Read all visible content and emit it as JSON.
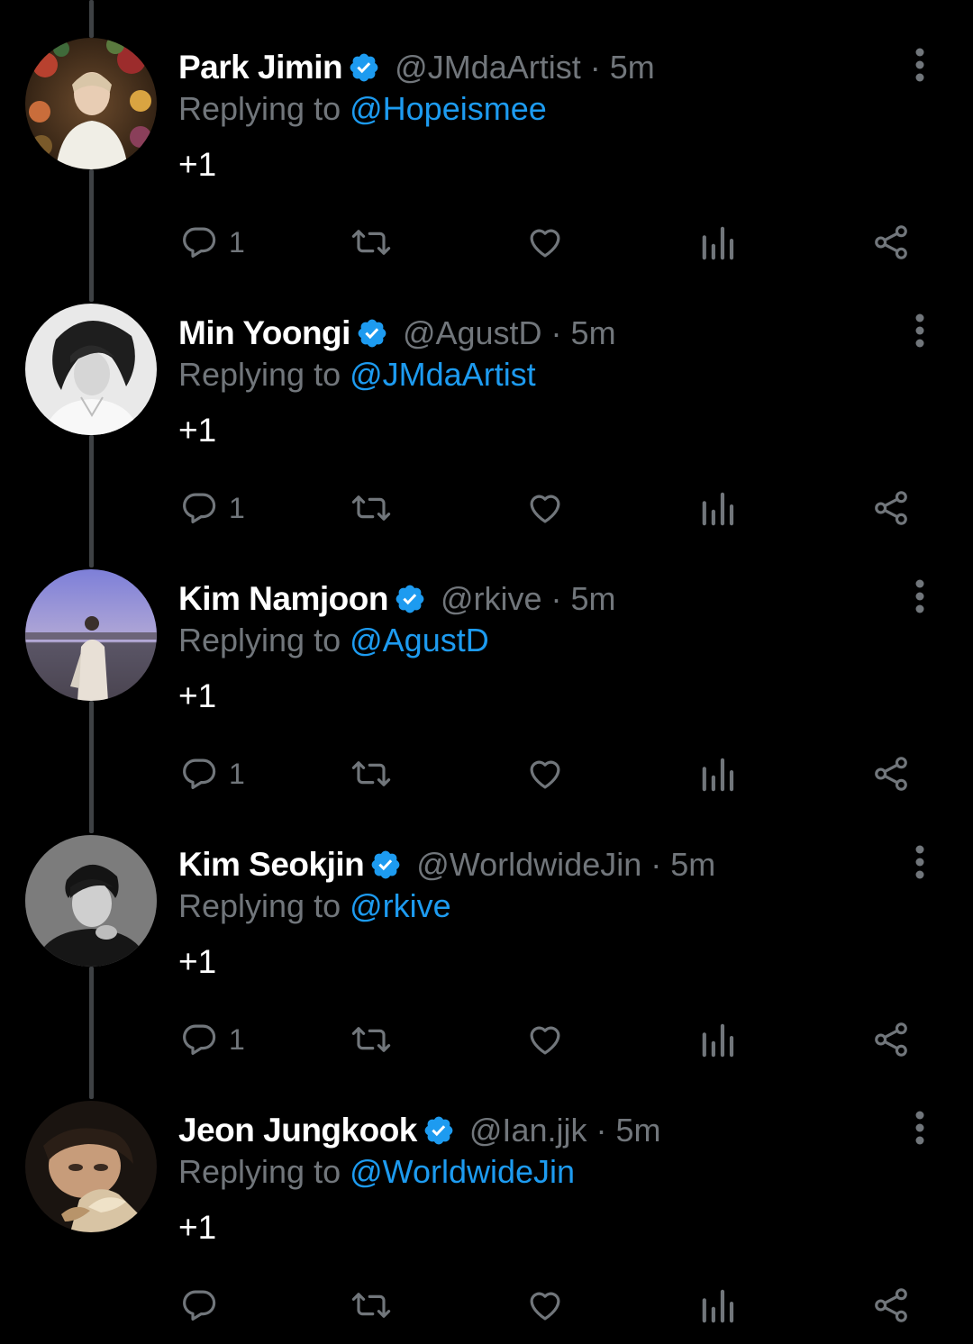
{
  "colors": {
    "background": "#000000",
    "name": "#ffffff",
    "secondary": "#71767b",
    "mention": "#1d9bf0",
    "verified": "#1d9bf0",
    "thread_line": "#3e4144"
  },
  "icons": {
    "reply": "reply-icon",
    "retweet": "retweet-icon",
    "like": "heart-icon",
    "views": "bar-chart-icon",
    "share": "share-icon",
    "more": "more-vertical-icon",
    "verified": "verified-badge-icon"
  },
  "tweets": [
    {
      "name": "Park Jimin",
      "handle": "@JMdaArtist",
      "separator": "·",
      "time": "5m",
      "replying_prefix": "Replying to ",
      "replying_to": "@Hopeismee",
      "text": "+1",
      "reply_count": "1"
    },
    {
      "name": "Min Yoongi",
      "handle": "@AgustD",
      "separator": "·",
      "time": "5m",
      "replying_prefix": "Replying to ",
      "replying_to": "@JMdaArtist",
      "text": "+1",
      "reply_count": "1"
    },
    {
      "name": "Kim Namjoon",
      "handle": "@rkive",
      "separator": "·",
      "time": "5m",
      "replying_prefix": "Replying to ",
      "replying_to": "@AgustD",
      "text": "+1",
      "reply_count": "1"
    },
    {
      "name": "Kim Seokjin",
      "handle": "@WorldwideJin",
      "separator": "·",
      "time": "5m",
      "replying_prefix": "Replying to ",
      "replying_to": "@rkive",
      "text": "+1",
      "reply_count": "1"
    },
    {
      "name": "Jeon Jungkook",
      "handle": "@Ian.jjk",
      "separator": "·",
      "time": "5m",
      "replying_prefix": "Replying to ",
      "replying_to": "@WorldwideJin",
      "text": "+1",
      "reply_count": ""
    }
  ]
}
